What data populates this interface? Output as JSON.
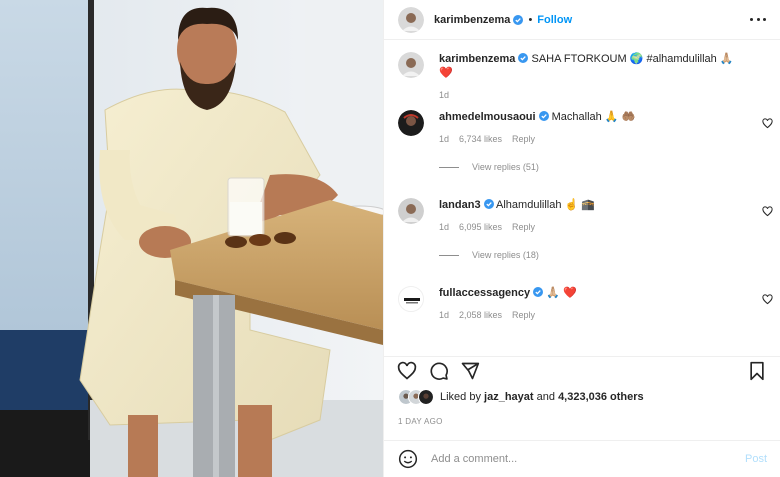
{
  "post": {
    "author": "karimbenzema",
    "follow_label": "Follow",
    "dot": "•"
  },
  "caption": {
    "username": "karimbenzema",
    "text": "SAHA FTORKOUM 🌍 #alhamdulillah 🙏🏼 ❤️",
    "time": "1d"
  },
  "comments": [
    {
      "username": "ahmedelmousaoui",
      "text": "Machallah 🙏 🤲🏽",
      "time": "1d",
      "likes": "6,734 likes",
      "reply": "Reply",
      "view_replies": "View replies (51)"
    },
    {
      "username": "landan3",
      "text": "Alhamdulillah ☝️ 🕋",
      "time": "1d",
      "likes": "6,095 likes",
      "reply": "Reply",
      "view_replies": "View replies (18)"
    },
    {
      "username": "fullaccessagency",
      "text": "🙏🏼 ❤️",
      "time": "1d",
      "likes": "2,058 likes",
      "reply": "Reply"
    }
  ],
  "likes_line": {
    "prefix": "Liked by",
    "user": "jaz_hayat",
    "and": "and",
    "others": "4,323,036 others"
  },
  "timestamp": "1 DAY AGO",
  "add_comment": {
    "placeholder": "Add a comment...",
    "post_label": "Post"
  },
  "colors": {
    "link": "#0095f6",
    "verified": "#3897f0",
    "muted": "#8e8e8e"
  }
}
